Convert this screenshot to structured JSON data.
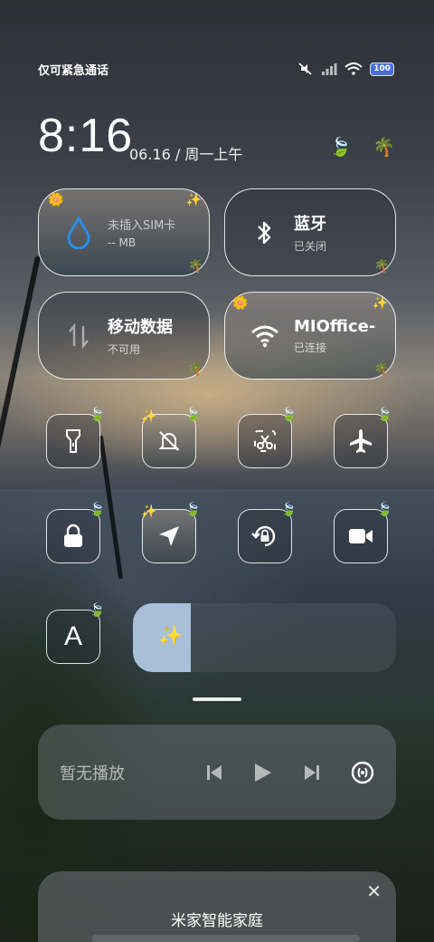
{
  "status_bar": {
    "carrier": "仅可紧急通话",
    "battery": "100",
    "icons": [
      "mute-icon",
      "signal-icon",
      "wifi-icon",
      "battery-icon"
    ]
  },
  "clock": {
    "time": "8:16",
    "date": "06.16 / 周一上午"
  },
  "tiles": {
    "sim": {
      "title": "未插入SIM卡",
      "sub": "-- MB",
      "icon": "water-drop-icon"
    },
    "bluetooth": {
      "title": "蓝牙",
      "sub": "已关闭",
      "icon": "bluetooth-icon"
    },
    "mobile_data": {
      "title": "移动数据",
      "sub": "不可用",
      "icon": "data-arrows-icon"
    },
    "wifi": {
      "title": "MIOffice-",
      "sub": "已连接",
      "icon": "wifi-icon"
    }
  },
  "toggles": [
    {
      "id": "flashlight",
      "icon": "flashlight-icon"
    },
    {
      "id": "mute",
      "icon": "bell-off-icon"
    },
    {
      "id": "screenshot",
      "icon": "scissors-icon"
    },
    {
      "id": "airplane",
      "icon": "airplane-icon"
    },
    {
      "id": "lock",
      "icon": "lock-icon"
    },
    {
      "id": "location",
      "icon": "location-arrow-icon"
    },
    {
      "id": "rotation",
      "icon": "rotation-lock-icon"
    },
    {
      "id": "screen-record",
      "icon": "video-camera-icon"
    }
  ],
  "auto_brightness": {
    "label": "A"
  },
  "brightness": {
    "level": 0.22,
    "fill_color": "#a9bed8"
  },
  "media": {
    "status": "暂无播放"
  },
  "smart_home": {
    "title": "米家智能家庭",
    "close": "✕"
  }
}
